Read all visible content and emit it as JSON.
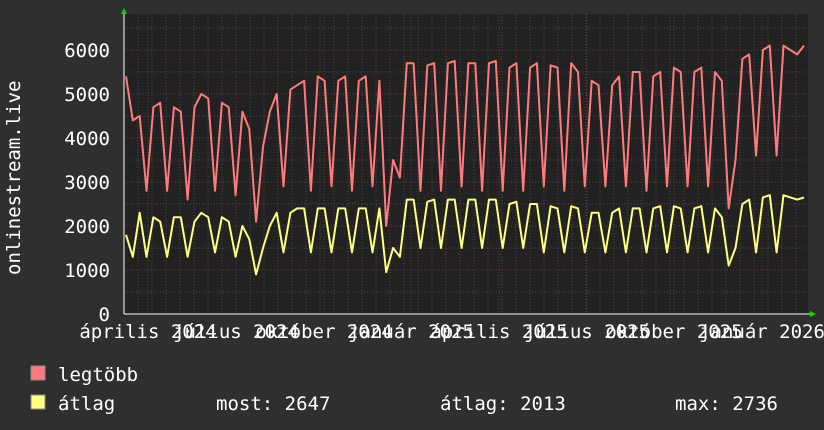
{
  "chart_data": {
    "type": "line",
    "ylabel": "onlinestream.live",
    "ylim": [
      0,
      6800
    ],
    "yticks": [
      0,
      1000,
      2000,
      3000,
      4000,
      5000,
      6000
    ],
    "xticks": [
      "április 2024",
      "július 2024",
      "október 2024",
      "január 2025",
      "április 2025",
      "július 2025",
      "október 2025",
      "január 2026"
    ],
    "grid": true,
    "legend_placement": "bottom",
    "series": [
      {
        "name": "legtöbb",
        "color": "#ff7b7b",
        "values": [
          5400,
          4400,
          4500,
          2800,
          4700,
          4800,
          2800,
          4700,
          4600,
          2600,
          4700,
          5000,
          4900,
          2800,
          4800,
          4700,
          2700,
          4600,
          4200,
          2100,
          3800,
          4600,
          5000,
          2900,
          5100,
          5200,
          5300,
          2800,
          5400,
          5300,
          2900,
          5300,
          5400,
          2800,
          5300,
          5400,
          2900,
          5300,
          2000,
          3500,
          3100,
          5700,
          5700,
          2800,
          5650,
          5700,
          2800,
          5700,
          5750,
          2900,
          5700,
          5700,
          2800,
          5700,
          5750,
          2800,
          5600,
          5700,
          2800,
          5600,
          5700,
          2900,
          5650,
          5600,
          2800,
          5700,
          5500,
          2900,
          5300,
          5200,
          2900,
          5200,
          5400,
          2900,
          5500,
          5500,
          2800,
          5400,
          5500,
          2900,
          5600,
          5500,
          2900,
          5500,
          5600,
          2900,
          5500,
          5300,
          2400,
          3500,
          5800,
          5900,
          3600,
          6000,
          6100,
          3600,
          6100,
          6000,
          5900,
          6100
        ]
      },
      {
        "name": "átlag",
        "color": "#ffff80",
        "values": [
          1800,
          1300,
          2300,
          1300,
          2200,
          2100,
          1300,
          2200,
          2200,
          1300,
          2100,
          2300,
          2200,
          1400,
          2200,
          2100,
          1300,
          2000,
          1700,
          900,
          1500,
          2000,
          2300,
          1400,
          2300,
          2400,
          2400,
          1400,
          2400,
          2400,
          1400,
          2400,
          2400,
          1400,
          2400,
          2400,
          1400,
          2400,
          950,
          1500,
          1300,
          2600,
          2600,
          1500,
          2550,
          2600,
          1500,
          2600,
          2600,
          1500,
          2600,
          2600,
          1500,
          2600,
          2600,
          1500,
          2500,
          2550,
          1500,
          2500,
          2500,
          1400,
          2450,
          2400,
          1400,
          2450,
          2400,
          1400,
          2300,
          2300,
          1400,
          2300,
          2400,
          1400,
          2400,
          2400,
          1400,
          2400,
          2450,
          1400,
          2450,
          2400,
          1400,
          2400,
          2450,
          1400,
          2400,
          2200,
          1100,
          1500,
          2500,
          2600,
          1400,
          2650,
          2700,
          1400,
          2700,
          2650,
          2600,
          2647
        ]
      }
    ]
  },
  "legend": {
    "items": [
      {
        "label": "legtöbb",
        "color": "#ff7b7b"
      },
      {
        "label": "átlag",
        "color": "#ffff80"
      }
    ],
    "stats": {
      "now": "most: 2647",
      "avg": "átlag: 2013",
      "max": "max: 2736"
    }
  }
}
